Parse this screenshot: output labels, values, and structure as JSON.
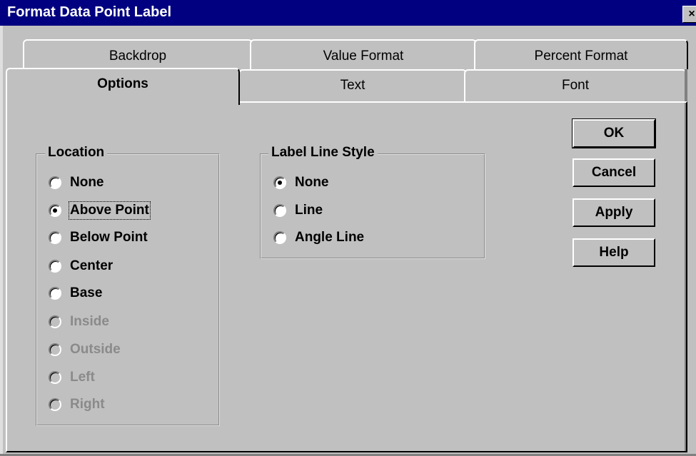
{
  "window": {
    "title": "Format Data Point Label",
    "close_glyph": "×"
  },
  "tabs_back": [
    {
      "label": "Backdrop"
    },
    {
      "label": "Value Format"
    },
    {
      "label": "Percent Format"
    }
  ],
  "tabs_front": [
    {
      "label": "Options",
      "active": true
    },
    {
      "label": "Text"
    },
    {
      "label": "Font"
    }
  ],
  "location": {
    "title": "Location",
    "options": [
      {
        "label": "None",
        "checked": false,
        "enabled": true
      },
      {
        "label": "Above Point",
        "checked": true,
        "enabled": true
      },
      {
        "label": "Below Point",
        "checked": false,
        "enabled": true
      },
      {
        "label": "Center",
        "checked": false,
        "enabled": true
      },
      {
        "label": "Base",
        "checked": false,
        "enabled": true
      },
      {
        "label": "Inside",
        "checked": false,
        "enabled": false
      },
      {
        "label": "Outside",
        "checked": false,
        "enabled": false
      },
      {
        "label": "Left",
        "checked": false,
        "enabled": false
      },
      {
        "label": "Right",
        "checked": false,
        "enabled": false
      }
    ]
  },
  "label_line_style": {
    "title": "Label Line Style",
    "options": [
      {
        "label": "None",
        "checked": true,
        "enabled": true
      },
      {
        "label": "Line",
        "checked": false,
        "enabled": true
      },
      {
        "label": "Angle Line",
        "checked": false,
        "enabled": true
      }
    ]
  },
  "buttons": {
    "ok": "OK",
    "cancel": "Cancel",
    "apply": "Apply",
    "help": "Help"
  },
  "colors": {
    "title_bar": "#000080",
    "face": "#c0c0c0",
    "disabled_text": "#8a8a8a"
  }
}
